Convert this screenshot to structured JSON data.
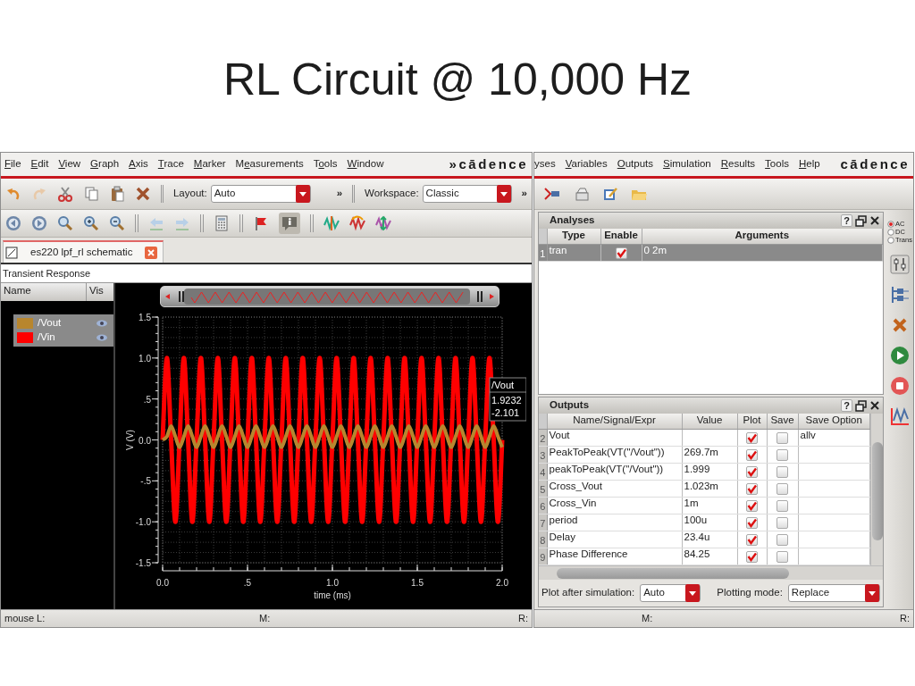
{
  "slide_title": "RL Circuit @ 10,000 Hz",
  "viewer": {
    "menu": [
      {
        "key": "F",
        "after": "ile"
      },
      {
        "key": "E",
        "after": "dit"
      },
      {
        "key": "V",
        "after": "iew"
      },
      {
        "key": "G",
        "after": "raph"
      },
      {
        "key": "A",
        "after": "xis"
      },
      {
        "key": "T",
        "after": "race"
      },
      {
        "key": "M",
        "after": "arker"
      },
      {
        "before": "M",
        "key": "e",
        "after": "asurements"
      },
      {
        "before": "T",
        "key": "o",
        "after": "ols"
      },
      {
        "key": "W",
        "after": "indow"
      }
    ],
    "logo": "»cādence",
    "layout": {
      "label": "Layout:",
      "value": "Auto",
      "more": "»"
    },
    "workspace": {
      "label": "Workspace:",
      "value": "Classic",
      "more": "»"
    },
    "info_selected": true,
    "tab": {
      "label": "es220 lpf_rl schematic",
      "selected": true
    },
    "plot_title": "Transient Response",
    "legend_columns": [
      "Name",
      "Vis"
    ],
    "chart_data": {
      "type": "line",
      "xlabel": "time (ms)",
      "ylabel": "V (V)",
      "x": [
        0,
        0.025,
        0.05,
        0.075,
        0.1,
        0.125,
        0.15,
        0.175,
        0.2,
        0.225,
        0.25,
        0.275,
        0.3,
        0.325,
        0.35,
        0.375,
        0.4,
        0.425,
        0.45,
        0.475,
        0.5,
        0.525,
        0.55,
        0.575,
        0.6,
        0.625,
        0.65,
        0.675,
        0.7,
        0.725,
        0.75,
        0.775,
        0.8,
        0.825,
        0.85,
        0.875,
        0.9,
        0.925,
        0.95,
        0.975,
        1,
        1.025,
        1.05,
        1.075,
        1.1,
        1.125,
        1.15,
        1.175,
        1.2,
        1.225,
        1.25,
        1.275,
        1.3,
        1.325,
        1.35,
        1.375,
        1.4,
        1.425,
        1.45,
        1.475,
        1.5,
        1.525,
        1.55,
        1.575,
        1.6,
        1.625,
        1.65,
        1.675,
        1.7,
        1.725,
        1.75,
        1.775,
        1.8,
        1.825,
        1.85,
        1.875,
        1.9,
        1.925,
        1.95,
        1.975,
        2
      ],
      "series": [
        {
          "name": "/Vout",
          "color": "#b8862e",
          "values": [
            0,
            0.04,
            0.17,
            0.04,
            -0.09,
            0.04,
            0.17,
            0.04,
            -0.09,
            0.04,
            0.17,
            0.04,
            -0.09,
            0.04,
            0.17,
            0.04,
            -0.09,
            0.04,
            0.17,
            0.04,
            -0.09,
            0.04,
            0.17,
            0.04,
            -0.09,
            0.04,
            0.17,
            0.04,
            -0.09,
            0.04,
            0.17,
            0.04,
            -0.09,
            0.04,
            0.17,
            0.04,
            -0.09,
            0.04,
            0.17,
            0.04,
            -0.09,
            0.04,
            0.17,
            0.04,
            -0.09,
            0.04,
            0.17,
            0.04,
            -0.09,
            0.04,
            0.17,
            0.04,
            -0.09,
            0.04,
            0.17,
            0.04,
            -0.09,
            0.04,
            0.17,
            0.04,
            -0.09,
            0.04,
            0.17,
            0.04,
            -0.09,
            0.04,
            0.17,
            0.04,
            -0.09,
            0.04,
            0.17,
            0.04,
            -0.09,
            0.04,
            0.17,
            0.04,
            -0.09,
            0.04,
            0.17,
            0.04,
            -0.09
          ]
        },
        {
          "name": "/Vin",
          "color": "#ff0000",
          "values": [
            0,
            1,
            0,
            -1,
            0,
            1,
            0,
            -1,
            0,
            1,
            0,
            -1,
            0,
            1,
            0,
            -1,
            0,
            1,
            0,
            -1,
            0,
            1,
            0,
            -1,
            0,
            1,
            0,
            -1,
            0,
            1,
            0,
            -1,
            0,
            1,
            0,
            -1,
            0,
            1,
            0,
            -1,
            0,
            1,
            0,
            -1,
            0,
            1,
            0,
            -1,
            0,
            1,
            0,
            -1,
            0,
            1,
            0,
            -1,
            0,
            1,
            0,
            -1,
            0,
            1,
            0,
            -1,
            0,
            1,
            0,
            -1,
            0,
            1,
            0,
            -1,
            0,
            1,
            0,
            -1,
            0,
            1,
            0,
            -1,
            0
          ]
        }
      ],
      "xlim": [
        0,
        2
      ],
      "ylim": [
        -1.5,
        1.5
      ],
      "grid": true,
      "legend": "left",
      "xticks": [
        {
          "value": 0,
          "label": "0.0"
        },
        {
          "value": 0.5,
          "label": ".5"
        },
        {
          "value": 1,
          "label": "1.0"
        },
        {
          "value": 1.5,
          "label": "1.5"
        },
        {
          "value": 2,
          "label": "2.0"
        }
      ],
      "yticks": [
        {
          "value": -1.5,
          "label": "-1.5"
        },
        {
          "value": -1,
          "label": "-1.0"
        },
        {
          "value": -0.5,
          "label": "-.5"
        },
        {
          "value": 0,
          "label": "0.0"
        },
        {
          "value": 0.5,
          "label": ".5"
        },
        {
          "value": 1,
          "label": "1.0"
        },
        {
          "value": 1.5,
          "label": "1.5"
        }
      ]
    },
    "marker": {
      "trace": "/Vout",
      "values": [
        "1.9232",
        "-2.101"
      ]
    },
    "status": [
      "mouse L:",
      "M:",
      "R:"
    ]
  },
  "setup": {
    "menu": [
      {
        "before": "yses"
      },
      {
        "key": "V",
        "after": "ariables"
      },
      {
        "key": "O",
        "after": "utputs"
      },
      {
        "key": "S",
        "after": "imulation"
      },
      {
        "key": "R",
        "after": "esults"
      },
      {
        "key": "T",
        "after": "ools"
      },
      {
        "key": "H",
        "after": "elp"
      }
    ],
    "logo": "cādence",
    "analyses": {
      "title": "Analyses",
      "help": "?",
      "columns": [
        "Type",
        "Enable",
        "Arguments"
      ],
      "rows": [
        {
          "number": "1",
          "type": "tran",
          "enabled": true,
          "arguments": "0 2m",
          "selected": true
        }
      ]
    },
    "analysis_types": [
      {
        "label": "AC",
        "selected": true
      },
      {
        "label": "DC",
        "selected": false
      },
      {
        "label": "Trans",
        "selected": false
      }
    ],
    "outputs": {
      "title": "Outputs",
      "help": "?",
      "columns": [
        "Name/Signal/Expr",
        "Value",
        "Plot",
        "Save",
        "Save Option"
      ],
      "rows": [
        {
          "number": "2",
          "name": "Vout",
          "plot": true,
          "save": false,
          "save_option": "allv",
          "selected": false
        },
        {
          "number": "3",
          "name": "PeakToPeak(VT(\"/Vout\"))",
          "value": "269.7m",
          "plot": true,
          "save": false,
          "selected": false
        },
        {
          "number": "4",
          "name": "peakToPeak(VT(\"/Vout\"))",
          "value": "1.999",
          "plot": true,
          "save": false,
          "selected": false
        },
        {
          "number": "5",
          "name": "Cross_Vout",
          "value": "1.023m",
          "plot": true,
          "save": false,
          "selected": false
        },
        {
          "number": "6",
          "name": "Cross_Vin",
          "value": "1m",
          "plot": true,
          "save": false,
          "selected": false
        },
        {
          "number": "7",
          "name": "period",
          "value": "100u",
          "plot": true,
          "save": false,
          "selected": false
        },
        {
          "number": "8",
          "name": "Delay",
          "value": "23.4u",
          "plot": true,
          "save": false,
          "selected": false
        },
        {
          "number": "9",
          "name": "Phase Difference",
          "value": "84.25",
          "plot": true,
          "save": false,
          "selected": false
        }
      ]
    },
    "plot_after": {
      "label": "Plot after simulation:",
      "value": "Auto"
    },
    "plotting_mode": {
      "label": "Plotting mode:",
      "value": "Replace"
    },
    "status": [
      "M:",
      "R:"
    ]
  }
}
